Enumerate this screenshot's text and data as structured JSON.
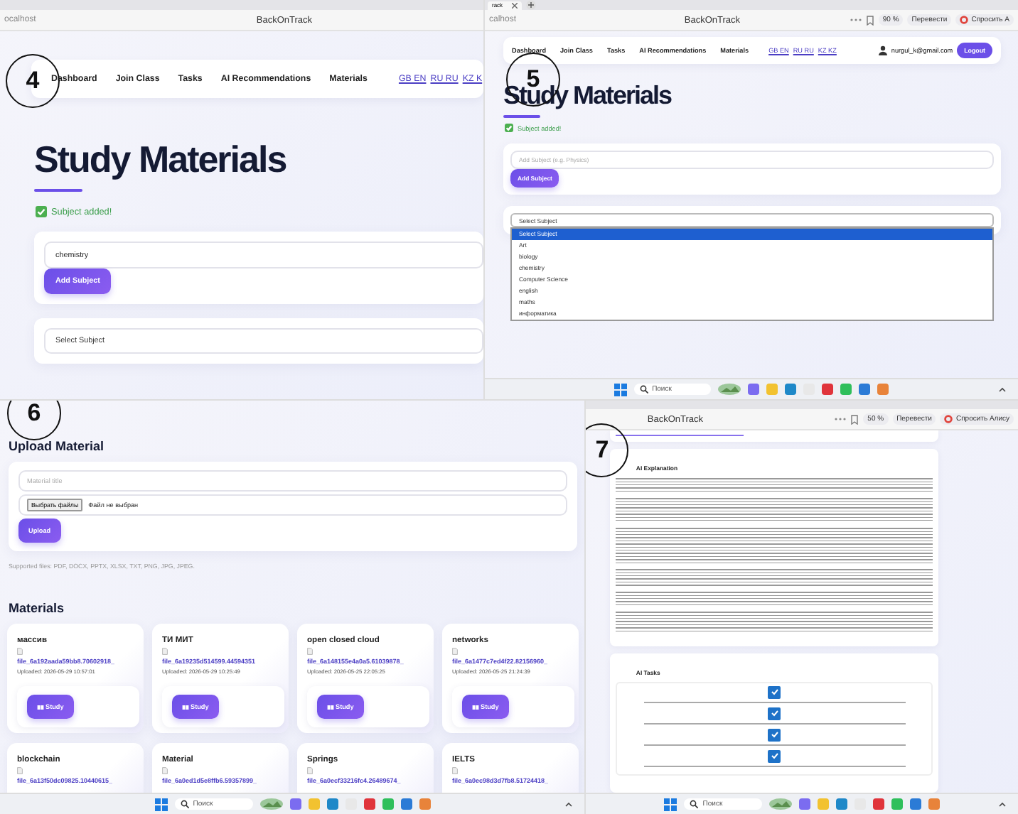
{
  "screenshot_4": {
    "number": "4",
    "browser": {
      "address": "ocalhost",
      "title": "BackOnTrack"
    },
    "nav": {
      "links": [
        "Dashboard",
        "Join Class",
        "Tasks",
        "AI Recommendations",
        "Materials"
      ],
      "languages": [
        "GB EN",
        "RU RU",
        "KZ K"
      ]
    },
    "heading": "Study Materials",
    "alert": "Subject added!",
    "subject_field": {
      "value": "chemistry"
    },
    "add_button": "Add Subject",
    "select": {
      "value": "Select Subject"
    }
  },
  "screenshot_5": {
    "number": "5",
    "browser": {
      "tab": "rack",
      "address": "calhost",
      "title": "BackOnTrack",
      "zoom": "90 %",
      "translate": "Перевести",
      "ask": "Спросить А"
    },
    "nav": {
      "links": [
        "Dashboard",
        "Join Class",
        "Tasks",
        "AI Recommendations",
        "Materials"
      ],
      "languages": [
        "GB EN",
        "RU RU",
        "KZ KZ"
      ],
      "user": "nurgul_k@gmail.com",
      "logout": "Logout"
    },
    "heading": "Study Materials",
    "alert": "Subject added!",
    "subject_field": {
      "placeholder": "Add Subject (e.g. Physics)"
    },
    "add_button": "Add Subject",
    "select": {
      "value": "Select Subject"
    },
    "options": [
      {
        "label": "Select Subject",
        "selected": true
      },
      {
        "label": "Art",
        "selected": false
      },
      {
        "label": "biology",
        "selected": false
      },
      {
        "label": "chemistry",
        "selected": false
      },
      {
        "label": "Computer Science",
        "selected": false
      },
      {
        "label": "english",
        "selected": false
      },
      {
        "label": "maths",
        "selected": false
      },
      {
        "label": "информатика",
        "selected": false
      }
    ],
    "taskbar": {
      "search": "Поиск"
    }
  },
  "screenshot_6": {
    "number": "6",
    "upload_heading": "Upload Material",
    "title_field": {
      "placeholder": "Material title"
    },
    "file_button": "Выбрать файлы",
    "file_status": "Файл не выбран",
    "upload_button": "Upload",
    "supported": "Supported files: PDF, DOCX, PPTX, XLSX, TXT, PNG, JPG, JPEG.",
    "materials_heading": "Materials",
    "materials": [
      {
        "title": "массив",
        "file": "file_6a192aada59bb8.70602918_",
        "uploaded": "Uploaded: 2026-05-29 10:57:01",
        "button": "Study"
      },
      {
        "title": "ТИ МИТ",
        "file": "file_6a19235d514599.44594351",
        "uploaded": "Uploaded: 2026-05-29 10:25:49",
        "button": "Study"
      },
      {
        "title": "open closed cloud",
        "file": "file_6a148155e4a0a5.61039878_",
        "uploaded": "Uploaded: 2026-05-25 22:05:25",
        "button": "Study"
      },
      {
        "title": "networks",
        "file": "file_6a1477c7ed4f22.82156960_",
        "uploaded": "Uploaded: 2026-05-25 21:24:39",
        "button": "Study"
      },
      {
        "title": "blockchain",
        "file": "file_6a13f50dc09825.10440615_"
      },
      {
        "title": "Material",
        "file": "file_6a0ed1d5e8ffb6.59357899_"
      },
      {
        "title": "Springs",
        "file": "file_6a0ecf33216fc4.26489674_"
      },
      {
        "title": "IELTS",
        "file": "file_6a0ec98d3d7fb8.51724418_"
      }
    ],
    "taskbar": {
      "search": "Поиск"
    }
  },
  "screenshot_7": {
    "number": "7",
    "browser": {
      "title": "BackOnTrack",
      "zoom": "50 %",
      "translate": "Перевести",
      "ask": "Спросить Алису"
    },
    "explanation_heading": "AI Explanation",
    "tasks_heading": "AI Tasks",
    "tasks": [
      {
        "checked": true
      },
      {
        "checked": true
      },
      {
        "checked": true
      },
      {
        "checked": true
      }
    ],
    "taskbar": {
      "search": "Поиск"
    }
  }
}
